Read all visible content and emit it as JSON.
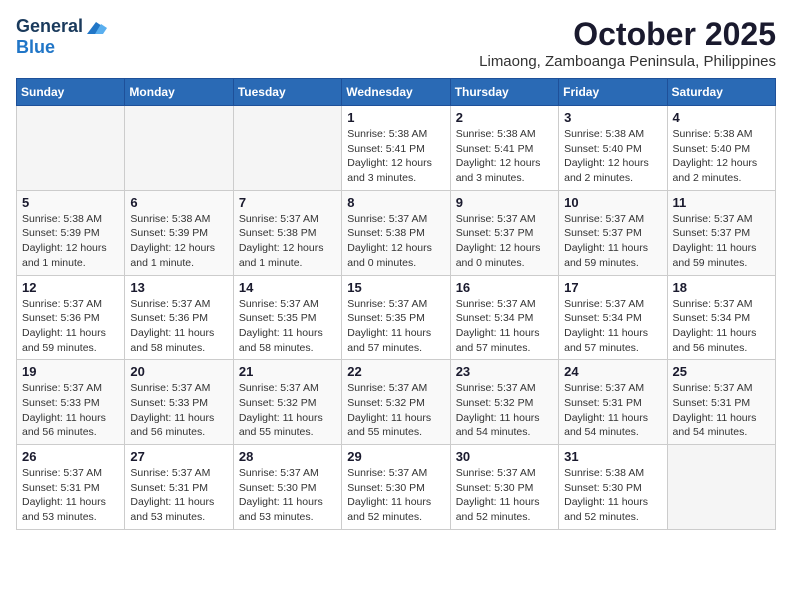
{
  "header": {
    "logo_general": "General",
    "logo_blue": "Blue",
    "month_title": "October 2025",
    "location": "Limaong, Zamboanga Peninsula, Philippines"
  },
  "days_of_week": [
    "Sunday",
    "Monday",
    "Tuesday",
    "Wednesday",
    "Thursday",
    "Friday",
    "Saturday"
  ],
  "weeks": [
    [
      {
        "day": "",
        "info": ""
      },
      {
        "day": "",
        "info": ""
      },
      {
        "day": "",
        "info": ""
      },
      {
        "day": "1",
        "info": "Sunrise: 5:38 AM\nSunset: 5:41 PM\nDaylight: 12 hours and 3 minutes."
      },
      {
        "day": "2",
        "info": "Sunrise: 5:38 AM\nSunset: 5:41 PM\nDaylight: 12 hours and 3 minutes."
      },
      {
        "day": "3",
        "info": "Sunrise: 5:38 AM\nSunset: 5:40 PM\nDaylight: 12 hours and 2 minutes."
      },
      {
        "day": "4",
        "info": "Sunrise: 5:38 AM\nSunset: 5:40 PM\nDaylight: 12 hours and 2 minutes."
      }
    ],
    [
      {
        "day": "5",
        "info": "Sunrise: 5:38 AM\nSunset: 5:39 PM\nDaylight: 12 hours and 1 minute."
      },
      {
        "day": "6",
        "info": "Sunrise: 5:38 AM\nSunset: 5:39 PM\nDaylight: 12 hours and 1 minute."
      },
      {
        "day": "7",
        "info": "Sunrise: 5:37 AM\nSunset: 5:38 PM\nDaylight: 12 hours and 1 minute."
      },
      {
        "day": "8",
        "info": "Sunrise: 5:37 AM\nSunset: 5:38 PM\nDaylight: 12 hours and 0 minutes."
      },
      {
        "day": "9",
        "info": "Sunrise: 5:37 AM\nSunset: 5:37 PM\nDaylight: 12 hours and 0 minutes."
      },
      {
        "day": "10",
        "info": "Sunrise: 5:37 AM\nSunset: 5:37 PM\nDaylight: 11 hours and 59 minutes."
      },
      {
        "day": "11",
        "info": "Sunrise: 5:37 AM\nSunset: 5:37 PM\nDaylight: 11 hours and 59 minutes."
      }
    ],
    [
      {
        "day": "12",
        "info": "Sunrise: 5:37 AM\nSunset: 5:36 PM\nDaylight: 11 hours and 59 minutes."
      },
      {
        "day": "13",
        "info": "Sunrise: 5:37 AM\nSunset: 5:36 PM\nDaylight: 11 hours and 58 minutes."
      },
      {
        "day": "14",
        "info": "Sunrise: 5:37 AM\nSunset: 5:35 PM\nDaylight: 11 hours and 58 minutes."
      },
      {
        "day": "15",
        "info": "Sunrise: 5:37 AM\nSunset: 5:35 PM\nDaylight: 11 hours and 57 minutes."
      },
      {
        "day": "16",
        "info": "Sunrise: 5:37 AM\nSunset: 5:34 PM\nDaylight: 11 hours and 57 minutes."
      },
      {
        "day": "17",
        "info": "Sunrise: 5:37 AM\nSunset: 5:34 PM\nDaylight: 11 hours and 57 minutes."
      },
      {
        "day": "18",
        "info": "Sunrise: 5:37 AM\nSunset: 5:34 PM\nDaylight: 11 hours and 56 minutes."
      }
    ],
    [
      {
        "day": "19",
        "info": "Sunrise: 5:37 AM\nSunset: 5:33 PM\nDaylight: 11 hours and 56 minutes."
      },
      {
        "day": "20",
        "info": "Sunrise: 5:37 AM\nSunset: 5:33 PM\nDaylight: 11 hours and 56 minutes."
      },
      {
        "day": "21",
        "info": "Sunrise: 5:37 AM\nSunset: 5:32 PM\nDaylight: 11 hours and 55 minutes."
      },
      {
        "day": "22",
        "info": "Sunrise: 5:37 AM\nSunset: 5:32 PM\nDaylight: 11 hours and 55 minutes."
      },
      {
        "day": "23",
        "info": "Sunrise: 5:37 AM\nSunset: 5:32 PM\nDaylight: 11 hours and 54 minutes."
      },
      {
        "day": "24",
        "info": "Sunrise: 5:37 AM\nSunset: 5:31 PM\nDaylight: 11 hours and 54 minutes."
      },
      {
        "day": "25",
        "info": "Sunrise: 5:37 AM\nSunset: 5:31 PM\nDaylight: 11 hours and 54 minutes."
      }
    ],
    [
      {
        "day": "26",
        "info": "Sunrise: 5:37 AM\nSunset: 5:31 PM\nDaylight: 11 hours and 53 minutes."
      },
      {
        "day": "27",
        "info": "Sunrise: 5:37 AM\nSunset: 5:31 PM\nDaylight: 11 hours and 53 minutes."
      },
      {
        "day": "28",
        "info": "Sunrise: 5:37 AM\nSunset: 5:30 PM\nDaylight: 11 hours and 53 minutes."
      },
      {
        "day": "29",
        "info": "Sunrise: 5:37 AM\nSunset: 5:30 PM\nDaylight: 11 hours and 52 minutes."
      },
      {
        "day": "30",
        "info": "Sunrise: 5:37 AM\nSunset: 5:30 PM\nDaylight: 11 hours and 52 minutes."
      },
      {
        "day": "31",
        "info": "Sunrise: 5:38 AM\nSunset: 5:30 PM\nDaylight: 11 hours and 52 minutes."
      },
      {
        "day": "",
        "info": ""
      }
    ]
  ]
}
